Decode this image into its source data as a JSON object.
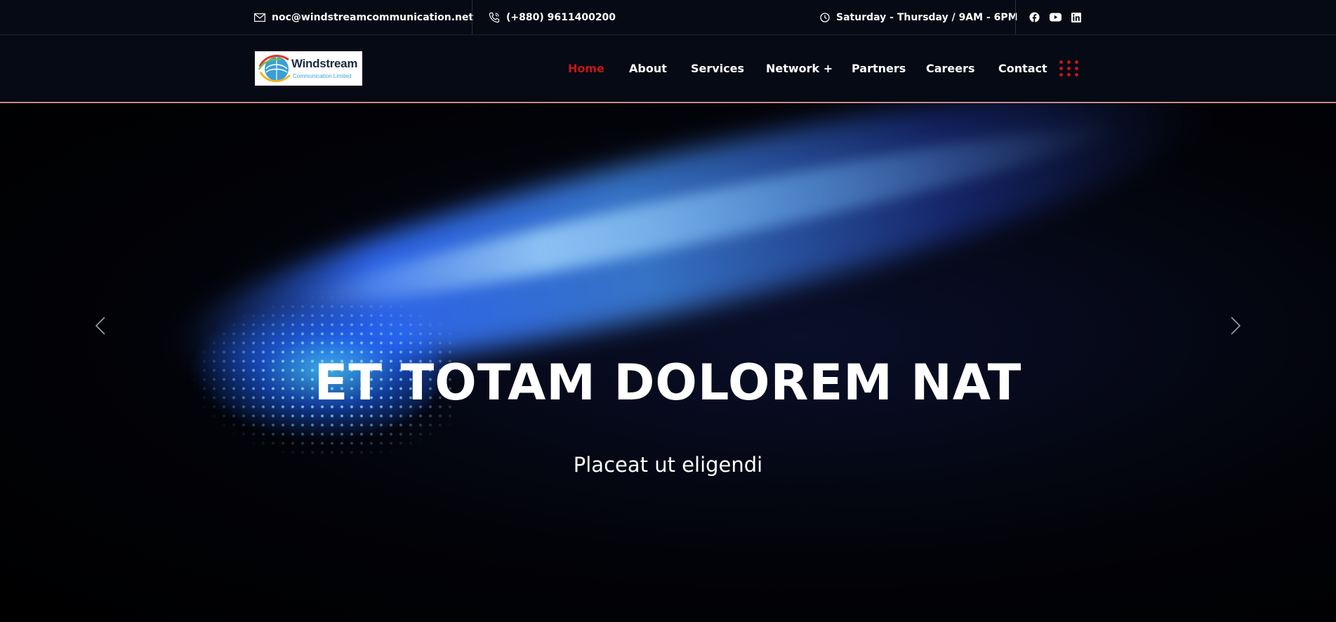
{
  "topbar": {
    "email": "noc@windstreamcommunication.net",
    "phone": "(+880) 9611400200",
    "hours": "Saturday - Thursday / 9AM - 6PM",
    "social": [
      "facebook-icon",
      "youtube-icon",
      "linkedin-icon"
    ]
  },
  "logo": {
    "name": "Windstream",
    "tagline": "Communication Limited"
  },
  "nav": {
    "items": [
      {
        "label": "Home",
        "active": true
      },
      {
        "label": "About"
      },
      {
        "label": "Services"
      },
      {
        "label": "Network +"
      },
      {
        "label": "Partners"
      },
      {
        "label": "Careers"
      },
      {
        "label": "Contact"
      }
    ],
    "menu_icon": "grid-dots-icon"
  },
  "hero": {
    "title": "ET TOTAM DOLOREM NAT",
    "subtitle": "Placeat ut eligendi"
  },
  "colors": {
    "accent": "#c41515",
    "bar_bg": "#050a14",
    "nav_border": "#c98a86"
  }
}
